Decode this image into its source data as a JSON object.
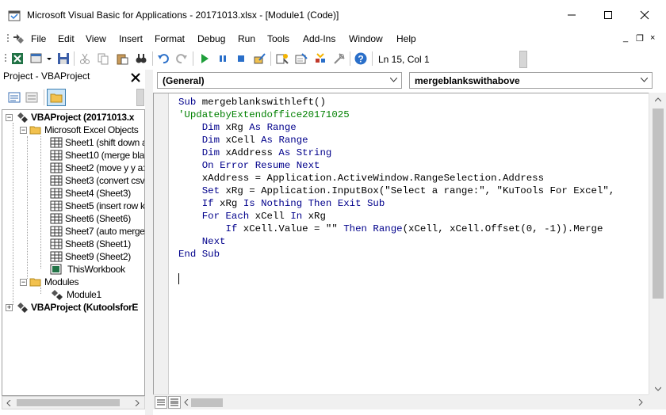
{
  "window": {
    "title": "Microsoft Visual Basic for Applications - 20171013.xlsx - [Module1 (Code)]"
  },
  "menu": {
    "items": [
      "File",
      "Edit",
      "View",
      "Insert",
      "Format",
      "Debug",
      "Run",
      "Tools",
      "Add-Ins",
      "Window",
      "Help"
    ],
    "mdi_controls": [
      "_",
      "❐",
      "×"
    ]
  },
  "toolbar": {
    "status": "Ln 15, Col 1"
  },
  "project": {
    "title": "Project - VBAProject",
    "tree": {
      "project1": "VBAProject (20171013.x",
      "excel_objects": "Microsoft Excel Objects",
      "sheets": [
        "Sheet1 (shift down a",
        "Sheet10 (merge blan",
        "Sheet2 (move y y a:",
        "Sheet3 (convert csv",
        "Sheet4 (Sheet3)",
        "Sheet5 (insert row k",
        "Sheet6 (Sheet6)",
        "Sheet7 (auto merge",
        "Sheet8 (Sheet1)",
        "Sheet9 (Sheet2)",
        "ThisWorkbook"
      ],
      "modules_folder": "Modules",
      "module": "Module1",
      "project2": "VBAProject (KutoolsforE"
    }
  },
  "code": {
    "object_combo": "(General)",
    "procedure_combo": "mergeblankswithabove",
    "lines": [
      "Sub mergeblankswithleft()",
      "'UpdatebyExtendoffice20171025",
      "    Dim xRg As Range",
      "    Dim xCell As Range",
      "    Dim xAddress As String",
      "    On Error Resume Next",
      "    xAddress = Application.ActiveWindow.RangeSelection.Address",
      "    Set xRg = Application.InputBox(\"Select a range:\", \"KuTools For Excel\",",
      "    If xRg Is Nothing Then Exit Sub",
      "    For Each xCell In xRg",
      "        If xCell.Value = \"\" Then Range(xCell, xCell.Offset(0, -1)).Merge",
      "    Next",
      "End Sub"
    ]
  },
  "colors": {
    "keyword": "#00008b",
    "comment": "#008000"
  }
}
